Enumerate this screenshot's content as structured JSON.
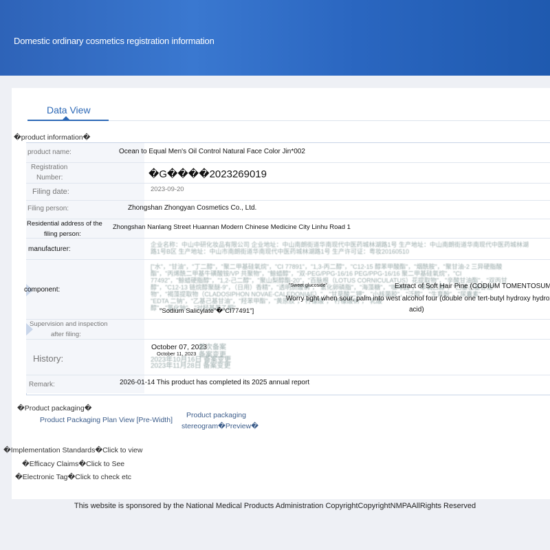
{
  "header": {
    "title": "Domestic ordinary cosmetics registration information"
  },
  "tabs": [
    {
      "label": "Data View"
    }
  ],
  "sections": {
    "product_info": "�product information�",
    "product_packaging": "�Product packaging�",
    "implementation_standards": "�Implementation Standards�Click to view",
    "efficacy_claims": "�Efficacy Claims�Click to See",
    "electronic_tag": "�Electronic Tag�Click to check etc"
  },
  "fields": {
    "product_name": {
      "label": "product name:",
      "value": "Ocean to Equal Men's Oil Control Natural Face Color Jin*002"
    },
    "registration_number": {
      "label_line1": "Registration",
      "label_line2": "Number:",
      "value": "�G����2023269019"
    },
    "filing_date": {
      "label": "Filing date:",
      "value": "2023-09-20"
    },
    "filing_person": {
      "label": "Filing person:",
      "value": "Zhongshan Zhongyan Cosmetics Co., Ltd."
    },
    "residential_address": {
      "label_line1": "Residential address of the",
      "label_line2": "filing person:",
      "value": "Zhongshan Nanlang Street Huannan Modern Chinese Medicine City Linhu Road 1"
    },
    "manufacturer": {
      "label": "manufacturer:",
      "value_line1": "企业名称：中山中研化妆品有限公司 企业地址：中山南朗街道华南现代中医药城林湖路1号 生产地址：中山南朗街道华南现代中医药城林湖",
      "value_line2": "路1号B区 生产地址：中山市南朗街道华南现代中医药城林湖路1号 生产许可证：粤妆20160510"
    },
    "component": {
      "label": "component:",
      "value_line1": "[\"水\"，\"甘油\"，\"丁二醇\"，\"聚二甲基硅氧烷\"，\"CI 77891\"，\"1,3-丙二醇\"，\"C12-15 醇苯甲酸酯\"，\"烟酰胺\"，\"聚甘油-2 三异硬脂酸",
      "value_line2": "酯\"，\"丙烯酰二甲基牛磺酸铵/VP 共聚物\"，\"鲸蜡醇\"，\"双-PEG/PPG-16/16 PEG/PPG-16/16 聚二甲基硅氧烷\"，\"CI",
      "value_line3": "77492\"，\"鲸蜡硬脂醇\"，\"1,2-己二醇\"，\"聚山梨醇酯-20\"，\"百脉根（LOTUS CORNICULATUS）花提取物\"，\"辛酸甘油酯\"，\"双丙甘",
      "value_line4": "醇\"，\"C12-13 链烷醇聚醚-9\"，（日用）香精\"，\"透明质酸钠\"，\"氢化卵磷脂\"，\"海藻糖\"，\"咖啡因\"，\"苯氧乙醇\"，\"乙基己基甘油\"",
      "value_line5": "物\"，\"褐藻提取物（CLADOSIPHON NOVAE-CALEDONIAE）\"，\"甘草酸二钾\"，\"小核菌胶\"，\"泛醇\"，\"生育酚\"，\"尿囊素\"",
      "value_line6": "\"EDTA 二钠\"，\"乙基己基甘油\"，\"羟苯甲酯\"，\"黄原胶\"，\"柠檬酸\"，\"柠檬酸钠\"，\"乳酸\"",
      "value_line7": "醇\"，\"氯化钠\"，\"对羟基苯乙酮\"",
      "overlay_sweet": "\"Sweet glucoside\"",
      "overlay_pine": "Extract of Soft Hair Pine (CODIUM TOMENTOSUM)",
      "overlay_worry_1": "Worry tight when sour, palm into west alcohol four (double one tert-butyl hydroxy hydroxy��",
      "overlay_worry_2": "acid)",
      "overlay_salicylate": "\"Sodium Salicylate\"�\"CI77491\"]"
    },
    "supervision": {
      "label_line1": "Supervision and inspection",
      "label_line2": "after filing:",
      "value": ""
    },
    "history": {
      "label": "History:",
      "entry1": "October 07, 2023",
      "entry2": "October 11, 2023",
      "entry_cn1": "首次备案",
      "entry_cn2": "备案变更",
      "entry_cn3": "2023年10月16日 备案变更",
      "entry_cn4": "2023年11月28日 备案变更"
    },
    "remark": {
      "label": "Remark:",
      "value": "2026-01-14 This product has completed its 2025 annual report"
    }
  },
  "packaging": {
    "plan_view": "Product Packaging Plan View [Pre-Width]",
    "stereogram_line1": "Product packaging",
    "stereogram_line2": "stereogram�Preview�"
  },
  "footer": {
    "text": "This website is sponsored by the National Medical Products Administration CopyrightCopyrightNMPAAllRights Reserved"
  },
  "colors": {
    "banner": "#2e63b8",
    "accent": "#2c68b6",
    "page_bg": "#eef0f5"
  }
}
